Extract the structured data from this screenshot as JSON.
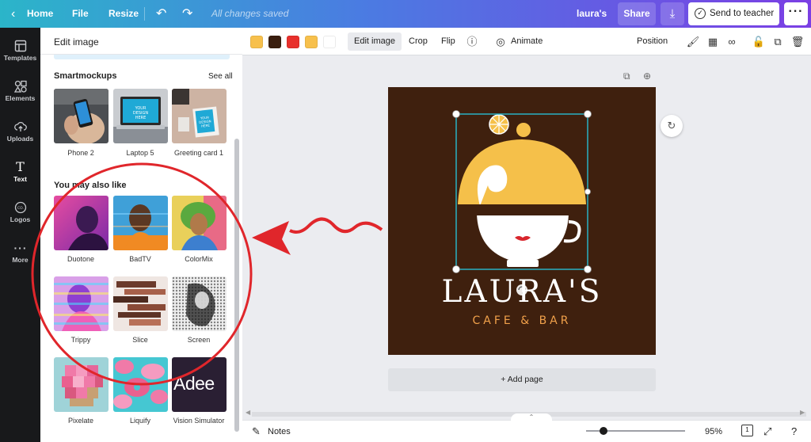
{
  "topbar": {
    "back_icon": "chevron-left-icon",
    "home_label": "Home",
    "file_label": "File",
    "resize_label": "Resize",
    "undo_icon": "undo-icon",
    "redo_icon": "redo-icon",
    "saved_status": "All changes saved",
    "design_title": "laura's",
    "share_label": "Share",
    "download_icon": "download-icon",
    "send_label": "Send to teacher",
    "send_icon": "check-circle-icon",
    "more_icon": "more-horizontal-icon"
  },
  "leftnav": {
    "items": [
      {
        "label": "Templates",
        "icon": "templates-icon"
      },
      {
        "label": "Elements",
        "icon": "elements-icon"
      },
      {
        "label": "Uploads",
        "icon": "upload-cloud-icon"
      },
      {
        "label": "Text",
        "icon": "text-icon"
      },
      {
        "label": "Logos",
        "icon": "logo-badge-icon"
      },
      {
        "label": "More",
        "icon": "more-dots-icon"
      }
    ]
  },
  "panel": {
    "title": "Edit image",
    "smartmockups": {
      "title": "Smartmockups",
      "see_all": "See all",
      "items": [
        {
          "label": "Phone 2"
        },
        {
          "label": "Laptop 5",
          "mock_text": "YOUR DESIGN HERE"
        },
        {
          "label": "Greeting card 1",
          "mock_text": "YOUR DESIGN HERE"
        }
      ]
    },
    "also_like": {
      "title": "You may also like",
      "items": [
        {
          "label": "Duotone"
        },
        {
          "label": "BadTV"
        },
        {
          "label": "ColorMix"
        },
        {
          "label": "Trippy"
        },
        {
          "label": "Slice"
        },
        {
          "label": "Screen"
        },
        {
          "label": "Pixelate"
        },
        {
          "label": "Liquify"
        },
        {
          "label": "Vision Simulator",
          "thumb_text": "Adee"
        }
      ]
    }
  },
  "toolbar": {
    "swatches": [
      "#f7c04c",
      "#3a1e0e",
      "#e8302c",
      "#f7c04c",
      "#ffffff"
    ],
    "edit_image": "Edit image",
    "crop": "Crop",
    "flip": "Flip",
    "info_icon": "info-icon",
    "animate_icon": "animate-icon",
    "animate": "Animate",
    "position": "Position",
    "paint_roller_icon": "paint-roller-icon",
    "transparency_icon": "transparency-icon",
    "link_icon": "link-icon",
    "lock_icon": "lock-icon",
    "duplicate_icon": "duplicate-icon",
    "delete_icon": "trash-icon"
  },
  "canvas": {
    "page_copy_icon": "copy-page-icon",
    "page_add_icon": "add-page-icon",
    "refresh_icon": "refresh-icon",
    "logo_name": "LAURA'S",
    "logo_subtitle": "CAFE & BAR",
    "add_page_label": "+ Add page",
    "colors": {
      "background": "#3f200e",
      "accent": "#f5c04a",
      "subtitle": "#f0a04a",
      "selection": "#28b1c4"
    }
  },
  "bottombar": {
    "notes_icon": "notes-icon",
    "notes_label": "Notes",
    "zoom_percent": "95%",
    "zoom_level": 0.95,
    "page_count": "1",
    "fullscreen_icon": "expand-icon",
    "help_icon": "help-icon",
    "collapse_icon": "chevron-up-icon"
  },
  "annotation": {
    "circle_color": "#e0262b",
    "arrow_color": "#e0262b"
  }
}
